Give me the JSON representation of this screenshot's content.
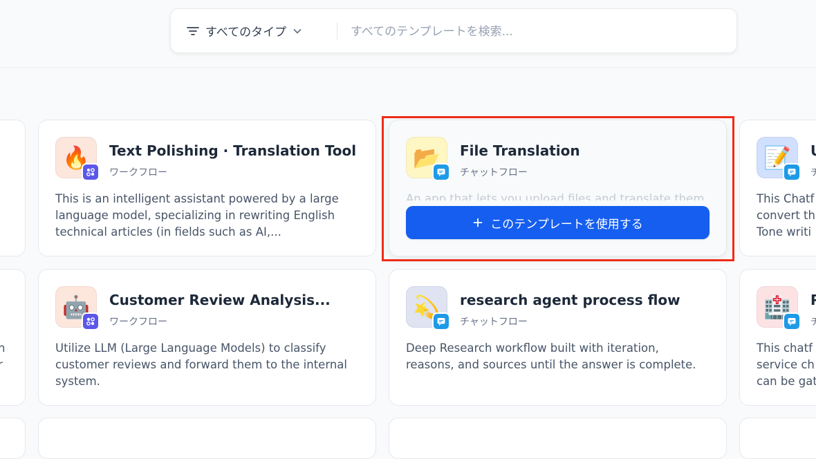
{
  "search": {
    "type_filter_label": "すべてのタイプ",
    "placeholder": "すべてのテンプレートを検索..."
  },
  "cards": {
    "c1": {
      "title": "Text Polishing · Translation Tool",
      "type": "ワークフロー",
      "icon": "fire-emoji",
      "desc": [
        "This is an intelligent assistant powered by a large",
        "language model, specializing in rewriting English",
        "technical articles (in fields such as AI,..."
      ]
    },
    "c2": {
      "title": "File Translation",
      "type": "チャットフロー",
      "icon": "folder-emoji",
      "desc": [
        "An app that lets you upload files and translate them"
      ],
      "use_button": "このテンプレートを使用する"
    },
    "c3": {
      "title": "U",
      "type": "チ",
      "icon": "memo-emoji",
      "desc": [
        "This Chatf",
        "convert th",
        "Tone writi"
      ]
    },
    "c4": {
      "title": "Customer Review Analysis...",
      "type": "ワークフロー",
      "icon": "robot-emoji",
      "desc": [
        "Utilize LLM (Large Language Models) to classify",
        "customer reviews and forward them to the internal",
        "system."
      ]
    },
    "c5": {
      "title": "research agent process flow",
      "type": "チャットフロー",
      "icon": "dizzy-star-emoji",
      "desc": [
        "Deep Research workflow built with iteration,",
        "reasons, and sources until the answer is complete."
      ]
    },
    "c6": {
      "title": "R",
      "type": "チ",
      "icon": "hospital-emoji",
      "desc": [
        "This chatf",
        "service ch",
        "can be gat"
      ]
    },
    "c7": {
      "desc": [
        "n",
        "r"
      ]
    }
  },
  "colors": {
    "primary": "#155eef",
    "highlight": "#ee2c17",
    "workflow_badge": "#5b57e8",
    "chatflow_badge": "#1e9ae7"
  }
}
